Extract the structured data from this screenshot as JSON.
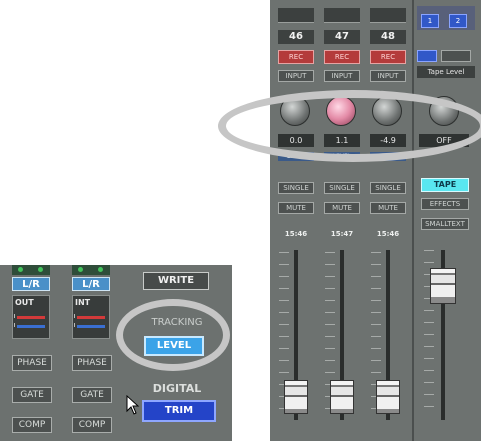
{
  "left_panel": {
    "channels": [
      {
        "assign": "L/R",
        "meter_label": "OUT",
        "buttons": [
          "PHASE",
          "GATE",
          "COMP"
        ]
      },
      {
        "assign": "L/R",
        "meter_label": "INT",
        "buttons": [
          "PHASE",
          "GATE",
          "COMP"
        ]
      }
    ],
    "write_label": "WRITE",
    "tracking_label": "TRACKING",
    "level_label": "LEVEL",
    "digital_label": "DIGITAL",
    "trim_label": "TRIM"
  },
  "right_panel": {
    "channels": [
      {
        "number": "46",
        "rec": "REC",
        "btn1": "INPUT",
        "value": "0.0",
        "level": "LEVEL",
        "btn2": "SINGLE",
        "btn3": "MUTE",
        "time": "15:46"
      },
      {
        "number": "47",
        "rec": "REC",
        "btn1": "INPUT",
        "value": "1.1",
        "level": "LEVEL",
        "btn2": "SINGLE",
        "btn3": "MUTE",
        "time": "15:47"
      },
      {
        "number": "48",
        "rec": "REC",
        "btn1": "INPUT",
        "value": "-4.9",
        "level": "LEVEL",
        "btn2": "SINGLE",
        "btn3": "MUTE",
        "time": "15:46"
      }
    ],
    "master": {
      "buttons": [
        "1",
        "2"
      ],
      "tape_level_label": "Tape Level",
      "value": "OFF",
      "tape_label": "TAPE",
      "effects_label": "EFFECTS",
      "small_label": "SMALLTEXT"
    }
  },
  "colors": {
    "panel_bg": "#6c716f",
    "highlight_ring": "#c6c6c6",
    "accent_blue": "#3ba3e8",
    "trim_blue": "#2444c8",
    "rec_red": "#b43b3b",
    "tape_cyan": "#59e6f0"
  }
}
